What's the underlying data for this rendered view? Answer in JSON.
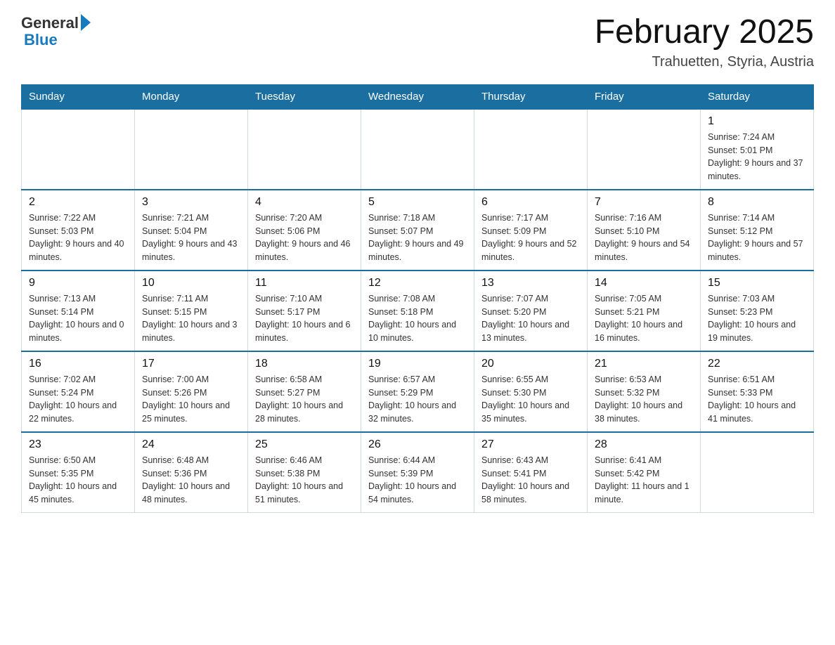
{
  "logo": {
    "general_text": "General",
    "blue_text": "Blue"
  },
  "title": {
    "month_year": "February 2025",
    "location": "Trahuetten, Styria, Austria"
  },
  "weekdays": [
    "Sunday",
    "Monday",
    "Tuesday",
    "Wednesday",
    "Thursday",
    "Friday",
    "Saturday"
  ],
  "weeks": [
    [
      {
        "day": "",
        "info": ""
      },
      {
        "day": "",
        "info": ""
      },
      {
        "day": "",
        "info": ""
      },
      {
        "day": "",
        "info": ""
      },
      {
        "day": "",
        "info": ""
      },
      {
        "day": "",
        "info": ""
      },
      {
        "day": "1",
        "info": "Sunrise: 7:24 AM\nSunset: 5:01 PM\nDaylight: 9 hours and 37 minutes."
      }
    ],
    [
      {
        "day": "2",
        "info": "Sunrise: 7:22 AM\nSunset: 5:03 PM\nDaylight: 9 hours and 40 minutes."
      },
      {
        "day": "3",
        "info": "Sunrise: 7:21 AM\nSunset: 5:04 PM\nDaylight: 9 hours and 43 minutes."
      },
      {
        "day": "4",
        "info": "Sunrise: 7:20 AM\nSunset: 5:06 PM\nDaylight: 9 hours and 46 minutes."
      },
      {
        "day": "5",
        "info": "Sunrise: 7:18 AM\nSunset: 5:07 PM\nDaylight: 9 hours and 49 minutes."
      },
      {
        "day": "6",
        "info": "Sunrise: 7:17 AM\nSunset: 5:09 PM\nDaylight: 9 hours and 52 minutes."
      },
      {
        "day": "7",
        "info": "Sunrise: 7:16 AM\nSunset: 5:10 PM\nDaylight: 9 hours and 54 minutes."
      },
      {
        "day": "8",
        "info": "Sunrise: 7:14 AM\nSunset: 5:12 PM\nDaylight: 9 hours and 57 minutes."
      }
    ],
    [
      {
        "day": "9",
        "info": "Sunrise: 7:13 AM\nSunset: 5:14 PM\nDaylight: 10 hours and 0 minutes."
      },
      {
        "day": "10",
        "info": "Sunrise: 7:11 AM\nSunset: 5:15 PM\nDaylight: 10 hours and 3 minutes."
      },
      {
        "day": "11",
        "info": "Sunrise: 7:10 AM\nSunset: 5:17 PM\nDaylight: 10 hours and 6 minutes."
      },
      {
        "day": "12",
        "info": "Sunrise: 7:08 AM\nSunset: 5:18 PM\nDaylight: 10 hours and 10 minutes."
      },
      {
        "day": "13",
        "info": "Sunrise: 7:07 AM\nSunset: 5:20 PM\nDaylight: 10 hours and 13 minutes."
      },
      {
        "day": "14",
        "info": "Sunrise: 7:05 AM\nSunset: 5:21 PM\nDaylight: 10 hours and 16 minutes."
      },
      {
        "day": "15",
        "info": "Sunrise: 7:03 AM\nSunset: 5:23 PM\nDaylight: 10 hours and 19 minutes."
      }
    ],
    [
      {
        "day": "16",
        "info": "Sunrise: 7:02 AM\nSunset: 5:24 PM\nDaylight: 10 hours and 22 minutes."
      },
      {
        "day": "17",
        "info": "Sunrise: 7:00 AM\nSunset: 5:26 PM\nDaylight: 10 hours and 25 minutes."
      },
      {
        "day": "18",
        "info": "Sunrise: 6:58 AM\nSunset: 5:27 PM\nDaylight: 10 hours and 28 minutes."
      },
      {
        "day": "19",
        "info": "Sunrise: 6:57 AM\nSunset: 5:29 PM\nDaylight: 10 hours and 32 minutes."
      },
      {
        "day": "20",
        "info": "Sunrise: 6:55 AM\nSunset: 5:30 PM\nDaylight: 10 hours and 35 minutes."
      },
      {
        "day": "21",
        "info": "Sunrise: 6:53 AM\nSunset: 5:32 PM\nDaylight: 10 hours and 38 minutes."
      },
      {
        "day": "22",
        "info": "Sunrise: 6:51 AM\nSunset: 5:33 PM\nDaylight: 10 hours and 41 minutes."
      }
    ],
    [
      {
        "day": "23",
        "info": "Sunrise: 6:50 AM\nSunset: 5:35 PM\nDaylight: 10 hours and 45 minutes."
      },
      {
        "day": "24",
        "info": "Sunrise: 6:48 AM\nSunset: 5:36 PM\nDaylight: 10 hours and 48 minutes."
      },
      {
        "day": "25",
        "info": "Sunrise: 6:46 AM\nSunset: 5:38 PM\nDaylight: 10 hours and 51 minutes."
      },
      {
        "day": "26",
        "info": "Sunrise: 6:44 AM\nSunset: 5:39 PM\nDaylight: 10 hours and 54 minutes."
      },
      {
        "day": "27",
        "info": "Sunrise: 6:43 AM\nSunset: 5:41 PM\nDaylight: 10 hours and 58 minutes."
      },
      {
        "day": "28",
        "info": "Sunrise: 6:41 AM\nSunset: 5:42 PM\nDaylight: 11 hours and 1 minute."
      },
      {
        "day": "",
        "info": ""
      }
    ]
  ]
}
